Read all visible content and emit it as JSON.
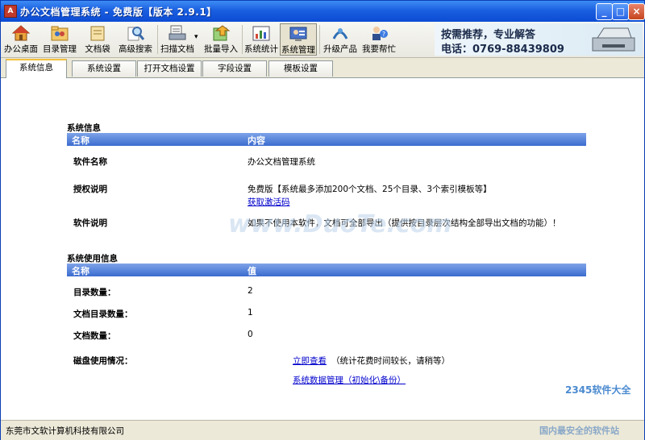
{
  "window": {
    "title": "办公文档管理系统   -  免费版【版本 2.9.1】",
    "app_icon": "A"
  },
  "titlebar_buttons": {
    "minimize": "_",
    "maximize": "□",
    "close": "×"
  },
  "toolbar": {
    "items": [
      {
        "label": "办公桌面",
        "icon": "house-icon"
      },
      {
        "label": "目录管理",
        "icon": "folder-people-icon"
      },
      {
        "label": "文档袋",
        "icon": "document-bag-icon"
      },
      {
        "label": "高级搜索",
        "icon": "search-icon"
      },
      {
        "label": "扫描文档",
        "icon": "scanner-icon"
      },
      {
        "label": "批量导入",
        "icon": "batch-import-icon"
      },
      {
        "label": "系统统计",
        "icon": "chart-icon"
      },
      {
        "label": "系统管理",
        "icon": "system-admin-icon"
      },
      {
        "label": "升级产品",
        "icon": "upgrade-icon"
      },
      {
        "label": "我要帮忙",
        "icon": "help-icon"
      }
    ],
    "scan_dropdown": "▾"
  },
  "banner": {
    "line1": "按需推荐，专业解答",
    "line2": "电话：0769-88439809"
  },
  "tabs": [
    "系统信息",
    "系统设置",
    "打开文档设置",
    "字段设置",
    "模板设置"
  ],
  "system_info": {
    "section_title": "系统信息",
    "col_name": "名称",
    "col_content": "内容",
    "software_name_label": "软件名称",
    "software_name_value": "办公文档管理系统",
    "license_label": "授权说明",
    "license_value": "免费版【系统最多添加200个文档、25个目录、3个索引模板等】",
    "activation_link": "获取激活码",
    "desc_label": "软件说明",
    "desc_value": "如果不使用本软件，文档可全部导出（提供按目录层次结构全部导出文档的功能）！"
  },
  "usage_info": {
    "section_title": "系统使用信息",
    "col_name": "名称",
    "col_value": "值",
    "dir_count_label": "目录数量：",
    "dir_count_value": "2",
    "doc_dir_count_label": "文档目录数量：",
    "doc_dir_count_value": "1",
    "doc_count_label": "文档数量：",
    "doc_count_value": "0",
    "disk_label": "磁盘使用情况：",
    "view_link": "立即查看",
    "view_note": "（统计花费时间较长，请稍等）",
    "data_mgmt_link": "系统数据管理（初始化\\备份）"
  },
  "statusbar": {
    "company": "东莞市文软计算机科技有限公司"
  },
  "watermarks": {
    "duote": "www.DuoTe.com",
    "site": "2345软件大全",
    "slogan": "国内最安全的软件站"
  },
  "colors": {
    "title_blue": "#0b4cd4",
    "header_blue": "#3b6ccf",
    "tab_accent": "#f3c03e",
    "link": "#0000cc"
  }
}
